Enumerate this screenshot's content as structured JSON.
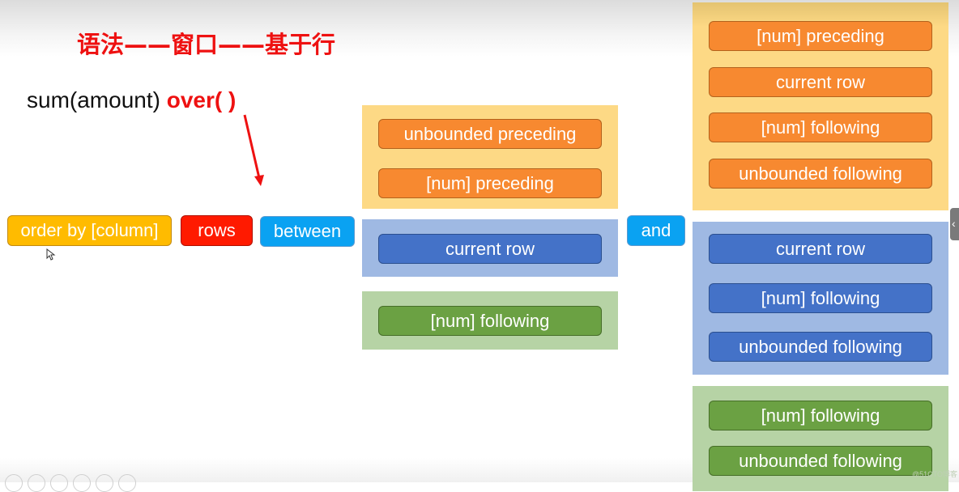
{
  "title": "语法——窗口——基于行",
  "formula": {
    "prefix": "sum(amount) ",
    "keyword": "over(  )"
  },
  "tags": {
    "order_by": "order by [column]",
    "rows": "rows",
    "between": "between",
    "and": "and"
  },
  "start_groups": {
    "preceding": [
      "unbounded preceding",
      "[num] preceding"
    ],
    "current": [
      "current row"
    ],
    "following": [
      "[num] following"
    ]
  },
  "end_groups": {
    "preceding": [
      "[num] preceding",
      "current row",
      "[num] following",
      "unbounded following"
    ],
    "current": [
      "current row",
      "[num] following",
      "unbounded following"
    ],
    "following": [
      "[num] following",
      "unbounded following"
    ]
  },
  "colors": {
    "title_red": "#ee1111",
    "order_by": "#ffbb00",
    "rows": "#ff1a00",
    "between_and": "#0aa2f2",
    "orange_pill": "#f78930",
    "blue_pill": "#4472c8",
    "green_pill": "#6ba143",
    "yellow_group": "#fdd985",
    "blue_group": "#9fb9e3",
    "green_group": "#b6d3a5"
  },
  "watermark": "@51CTO博客",
  "side_tab_icon": "chevron-left-icon"
}
